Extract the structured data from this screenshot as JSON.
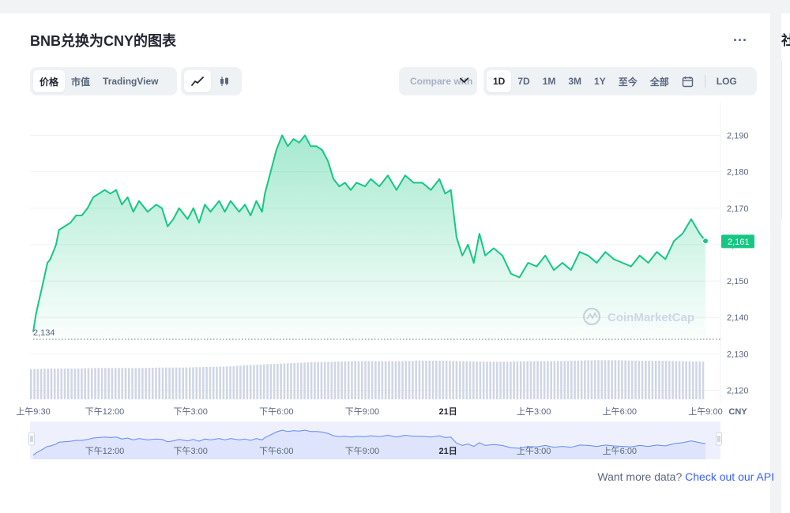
{
  "page": {
    "title": "BNB兑换为CNY的图表",
    "more_label": "...",
    "right_caption": "社"
  },
  "toolbar": {
    "metric_tabs": [
      "价格",
      "市值",
      "TradingView"
    ],
    "active_metric": "价格",
    "chart_types": [
      "line-chart-icon",
      "candlestick-icon"
    ],
    "active_chart_type": "line-chart-icon",
    "compare_label": "Compare with",
    "ranges": [
      "1D",
      "7D",
      "1M",
      "3M",
      "1Y",
      "至今",
      "全部"
    ],
    "active_range": "1D",
    "calendar_icon": "calendar-icon",
    "log_label": "LOG"
  },
  "footer": {
    "api_prefix": "Want more data?",
    "api_link": "Check out our API"
  },
  "colors": {
    "line": "#16c784",
    "volume": "#cfd6e4",
    "navigator_fill": "#dde4fb",
    "navigator_line": "#6188ff",
    "price_badge": "#16c784"
  },
  "chart_data": {
    "type": "area",
    "currency_label": "CNY",
    "watermark": "CoinMarketCap",
    "open_price_label": "2,134",
    "open_price": 2134,
    "last_price_label": "2,161",
    "last_price": 2161,
    "ylim": [
      2115,
      2200
    ],
    "y_ticks": [
      2120,
      2130,
      2140,
      2150,
      2160,
      2170,
      2180,
      2190
    ],
    "y_tick_labels": [
      "2,120",
      "2,130",
      "2,140",
      "2,150",
      "2,160",
      "2,170",
      "2,180",
      "2,190"
    ],
    "x_range_hours": [
      9.5,
      33.0
    ],
    "x_ticks": [
      {
        "label": "上午9:30",
        "h": 9.5,
        "bold": false
      },
      {
        "label": "下午12:00",
        "h": 12.0,
        "bold": false
      },
      {
        "label": "下午3:00",
        "h": 15.0,
        "bold": false
      },
      {
        "label": "下午6:00",
        "h": 18.0,
        "bold": false
      },
      {
        "label": "下午9:00",
        "h": 21.0,
        "bold": false
      },
      {
        "label": "21日",
        "h": 24.0,
        "bold": true
      },
      {
        "label": "上午3:00",
        "h": 27.0,
        "bold": false
      },
      {
        "label": "上午6:00",
        "h": 30.0,
        "bold": false
      },
      {
        "label": "上午9:00",
        "h": 33.0,
        "bold": false
      }
    ],
    "navigator_ticks": [
      {
        "label": "下午12:00",
        "h": 12.0,
        "bold": false
      },
      {
        "label": "下午3:00",
        "h": 15.0,
        "bold": false
      },
      {
        "label": "下午6:00",
        "h": 18.0,
        "bold": false
      },
      {
        "label": "下午9:00",
        "h": 21.0,
        "bold": false
      },
      {
        "label": "21日",
        "h": 24.0,
        "bold": true
      },
      {
        "label": "上午3:00",
        "h": 27.0,
        "bold": false
      },
      {
        "label": "上午6:00",
        "h": 30.0,
        "bold": false
      }
    ],
    "series": [
      {
        "x_hours": [
          9.5,
          9.6,
          9.8,
          10.0,
          10.1,
          10.3,
          10.4,
          10.6,
          10.8,
          11.0,
          11.2,
          11.4,
          11.6,
          11.8,
          12.0,
          12.2,
          12.4,
          12.6,
          12.8,
          13.0,
          13.2,
          13.5,
          13.8,
          14.0,
          14.2,
          14.4,
          14.6,
          14.9,
          15.1,
          15.3,
          15.5,
          15.7,
          16.0,
          16.2,
          16.4,
          16.7,
          16.9,
          17.1,
          17.3,
          17.5,
          17.6,
          17.8,
          18.0,
          18.2,
          18.4,
          18.6,
          18.8,
          19.0,
          19.2,
          19.4,
          19.6,
          19.8,
          20.0,
          20.2,
          20.4,
          20.6,
          20.8,
          21.1,
          21.3,
          21.6,
          21.9,
          22.2,
          22.5,
          22.8,
          23.1,
          23.4,
          23.7,
          23.9,
          24.1,
          24.3,
          24.5,
          24.7,
          24.9,
          25.1,
          25.3,
          25.6,
          25.9,
          26.2,
          26.5,
          26.8,
          27.1,
          27.4,
          27.7,
          28.0,
          28.3,
          28.6,
          28.9,
          29.2,
          29.5,
          29.8,
          30.1,
          30.4,
          30.7,
          31.0,
          31.3,
          31.6,
          31.9,
          32.2,
          32.5,
          32.8,
          33.0
        ],
        "values": [
          2136,
          2141,
          2148,
          2155,
          2156,
          2160,
          2164,
          2165,
          2166,
          2168,
          2168,
          2170,
          2173,
          2174,
          2175,
          2174,
          2175,
          2171,
          2173,
          2169,
          2172,
          2169,
          2171,
          2170,
          2165,
          2167,
          2170,
          2167,
          2170,
          2166,
          2171,
          2169,
          2172,
          2169,
          2172,
          2169,
          2171,
          2168,
          2172,
          2169,
          2174,
          2180,
          2186,
          2190,
          2187,
          2189,
          2188,
          2190,
          2187,
          2187,
          2186,
          2183,
          2178,
          2176,
          2177,
          2175,
          2177,
          2176,
          2178,
          2176,
          2179,
          2175,
          2179,
          2177,
          2177,
          2175,
          2178,
          2174,
          2175,
          2162,
          2157,
          2160,
          2155,
          2163,
          2157,
          2159,
          2157,
          2152,
          2151,
          2155,
          2154,
          2157,
          2153,
          2155,
          2153,
          2158,
          2157,
          2155,
          2158,
          2156,
          2155,
          2154,
          2157,
          2155,
          2158,
          2156,
          2161,
          2163,
          2167,
          2163,
          2161
        ]
      }
    ],
    "volume": {
      "note": "relative volume bar heights 0-1",
      "levels": [
        0.62,
        0.63,
        0.63,
        0.64,
        0.64,
        0.64,
        0.65,
        0.65,
        0.66,
        0.67,
        0.7,
        0.72,
        0.74,
        0.76,
        0.77,
        0.78,
        0.78,
        0.78,
        0.79,
        0.79,
        0.78,
        0.77,
        0.77,
        0.78,
        0.78,
        0.79,
        0.8,
        0.8,
        0.79,
        0.79,
        0.78,
        0.77
      ]
    }
  }
}
